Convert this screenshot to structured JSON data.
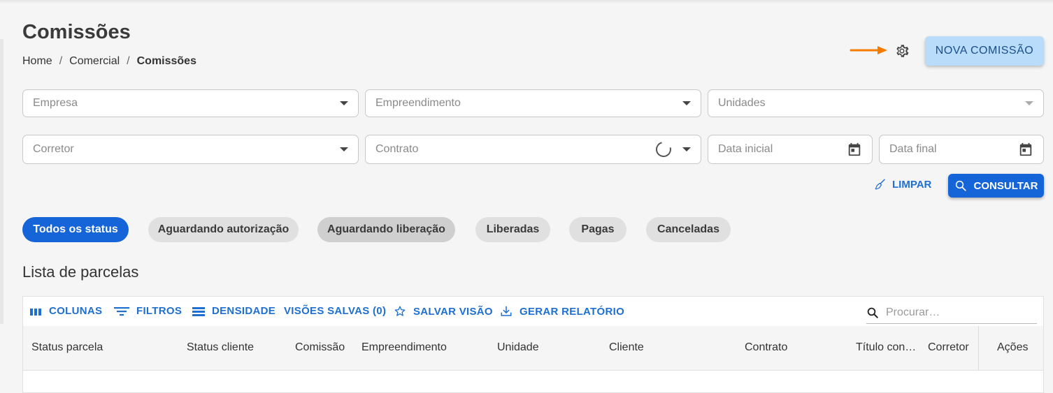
{
  "page": {
    "title": "Comissões",
    "breadcrumb": [
      "Home",
      "Comercial",
      "Comissões"
    ],
    "new_button": "NOVA COMISSÃO"
  },
  "filters": {
    "empresa": "Empresa",
    "empreendimento": "Empreendimento",
    "unidades": "Unidades",
    "corretor": "Corretor",
    "contrato": "Contrato",
    "data_inicial": "Data inicial",
    "data_final": "Data final",
    "clear": "LIMPAR",
    "consult": "CONSULTAR"
  },
  "status_chips": [
    "Todos os status",
    "Aguardando autorização",
    "Aguardando liberação",
    "Liberadas",
    "Pagas",
    "Canceladas"
  ],
  "list": {
    "title": "Lista de parcelas",
    "toolbar": {
      "columns": "COLUNAS",
      "filters": "FILTROS",
      "density": "DENSIDADE",
      "saved_views": "VISÕES SALVAS (0)",
      "save_view": "SALVAR VISÃO",
      "report": "GERAR RELATÓRIO",
      "search_placeholder": "Procurar…"
    },
    "columns": [
      "Status parcela",
      "Status cliente",
      "Comissão",
      "Empreendimento",
      "Unidade",
      "Cliente",
      "Contrato",
      "Título con…",
      "Corretor",
      "Ações"
    ]
  },
  "colors": {
    "accent": "#1565d8",
    "link": "#1e6fd0",
    "new_button_bg": "#b9dcfb",
    "annotation_arrow": "#f57c00"
  }
}
